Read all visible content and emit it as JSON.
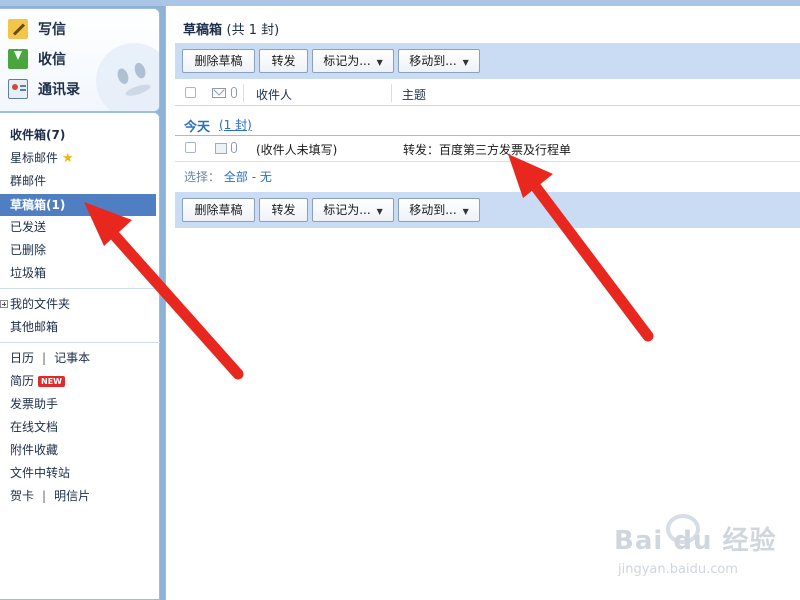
{
  "sidebar": {
    "quick": [
      {
        "label": "写信",
        "icon": "compose-icon"
      },
      {
        "label": "收信",
        "icon": "inbox-download-icon"
      },
      {
        "label": "通讯录",
        "icon": "contacts-icon"
      }
    ],
    "folders": {
      "inbox": "收件箱(7)",
      "starred": "星标邮件",
      "group": "群邮件",
      "drafts": "草稿箱(1)",
      "sent": "已发送",
      "deleted": "已删除",
      "trash": "垃圾箱"
    },
    "my_folders": "我的文件夹",
    "other_mailboxes": "其他邮箱",
    "tools": {
      "calendar": "日历",
      "notes": "记事本",
      "resume": "简历",
      "new_badge": "NEW",
      "invoice": "发票助手",
      "docs": "在线文档",
      "attachments": "附件收藏",
      "transfer": "文件中转站",
      "cards": "贺卡",
      "postcards": "明信片"
    },
    "separator": "|"
  },
  "main": {
    "title": "草稿箱",
    "title_count": "(共 1 封)",
    "toolbar": {
      "delete": "删除草稿",
      "forward": "转发",
      "mark": "标记为...",
      "move": "移动到..."
    },
    "columns": {
      "recipient": "收件人",
      "subject": "主题"
    },
    "group": {
      "label": "今天",
      "count_link": "(1 封)"
    },
    "rows": [
      {
        "recipient": "(收件人未填写)",
        "subject": "转发：百度第三方发票及行程单"
      }
    ],
    "select": {
      "label": "选择：",
      "all": "全部",
      "dash": "-",
      "none": "无"
    }
  },
  "watermark": {
    "brand": "Bai du 经验",
    "url": "jingyan.baidu.com"
  },
  "colors": {
    "selected_bg": "#4f7ec2",
    "toolbar_bg": "#c9dcf3",
    "link": "#2a6fc1",
    "arrow": "#e8281f"
  }
}
